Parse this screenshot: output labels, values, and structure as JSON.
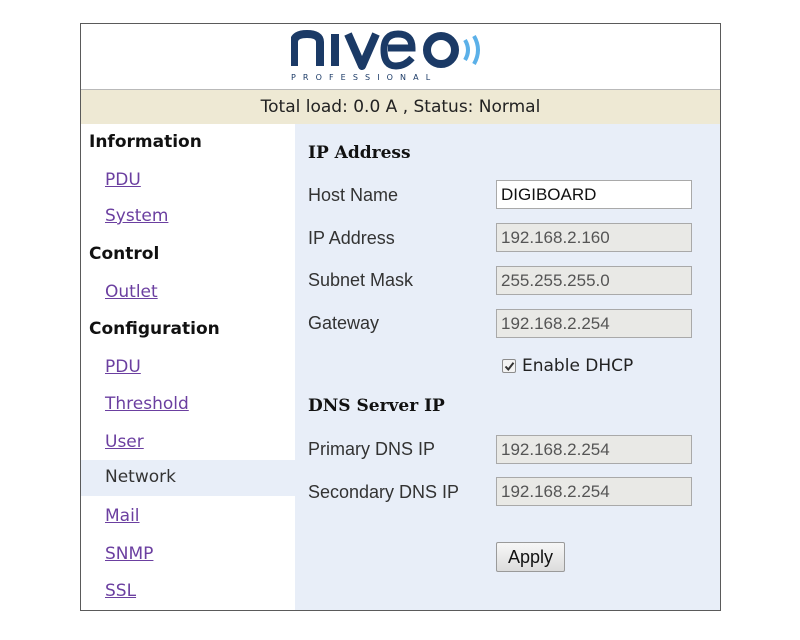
{
  "header": {
    "logo_text": "niveo",
    "logo_subtext": "PROFESSIONAL"
  },
  "status": {
    "text": "Total load: 0.0 A , Status: Normal"
  },
  "sidebar": {
    "sections": [
      {
        "title": "Information",
        "items": [
          "PDU",
          "System"
        ]
      },
      {
        "title": "Control",
        "items": [
          "Outlet"
        ]
      },
      {
        "title": "Configuration",
        "items": [
          "PDU",
          "Threshold",
          "User",
          "Network",
          "Mail",
          "SNMP",
          "SSL"
        ]
      }
    ],
    "active_item": "Network"
  },
  "main": {
    "ip_section": {
      "title": "IP Address",
      "fields": [
        {
          "label": "Host Name",
          "value": "DIGIBOARD",
          "editable": true
        },
        {
          "label": "IP Address",
          "value": "192.168.2.160",
          "editable": false
        },
        {
          "label": "Subnet Mask",
          "value": "255.255.255.0",
          "editable": false
        },
        {
          "label": "Gateway",
          "value": "192.168.2.254",
          "editable": false
        }
      ]
    },
    "dhcp": {
      "label": "Enable DHCP",
      "checked": true
    },
    "dns_section": {
      "title": "DNS Server IP",
      "fields": [
        {
          "label": "Primary DNS IP",
          "value": "192.168.2.254",
          "editable": false
        },
        {
          "label": "Secondary DNS IP",
          "value": "192.168.2.254",
          "editable": false
        }
      ]
    },
    "apply_label": "Apply"
  },
  "colors": {
    "status_bar_bg": "#eee9d4",
    "panel_bg": "#e8eef8",
    "link": "#6b3fa0",
    "logo_dark": "#1b3a66",
    "logo_accent": "#5bb0e8"
  }
}
